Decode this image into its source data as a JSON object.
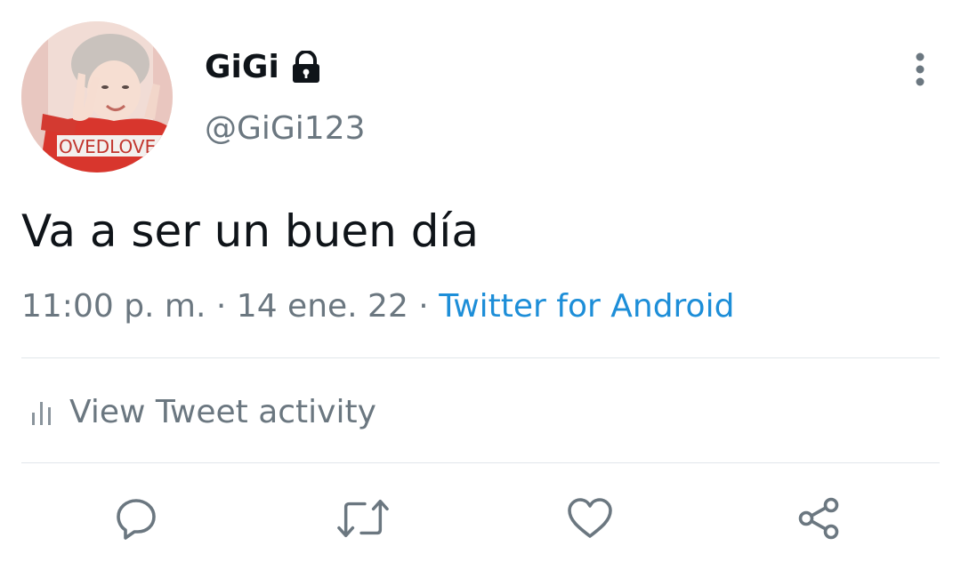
{
  "tweet": {
    "author": {
      "display_name": "GiGi",
      "handle": "@GiGi123",
      "protected_icon": "lock-icon",
      "avatar_print_text": "OVEDLOVE"
    },
    "text": "Va a ser un buen día",
    "time": "11:00 p. m.",
    "separator": " · ",
    "date": "14 ene. 22",
    "source": "Twitter for Android",
    "source_color": "#1d8ed8"
  },
  "activity": {
    "icon": "bar-chart-icon",
    "label": "View Tweet activity"
  },
  "actions": {
    "reply_icon": "reply-icon",
    "retweet_icon": "retweet-icon",
    "like_icon": "heart-icon",
    "share_icon": "share-icon"
  },
  "colors": {
    "primary_text": "#0f1419",
    "secondary_text": "#6b7780",
    "link": "#1d8ed8",
    "divider": "#e1e6ea"
  }
}
